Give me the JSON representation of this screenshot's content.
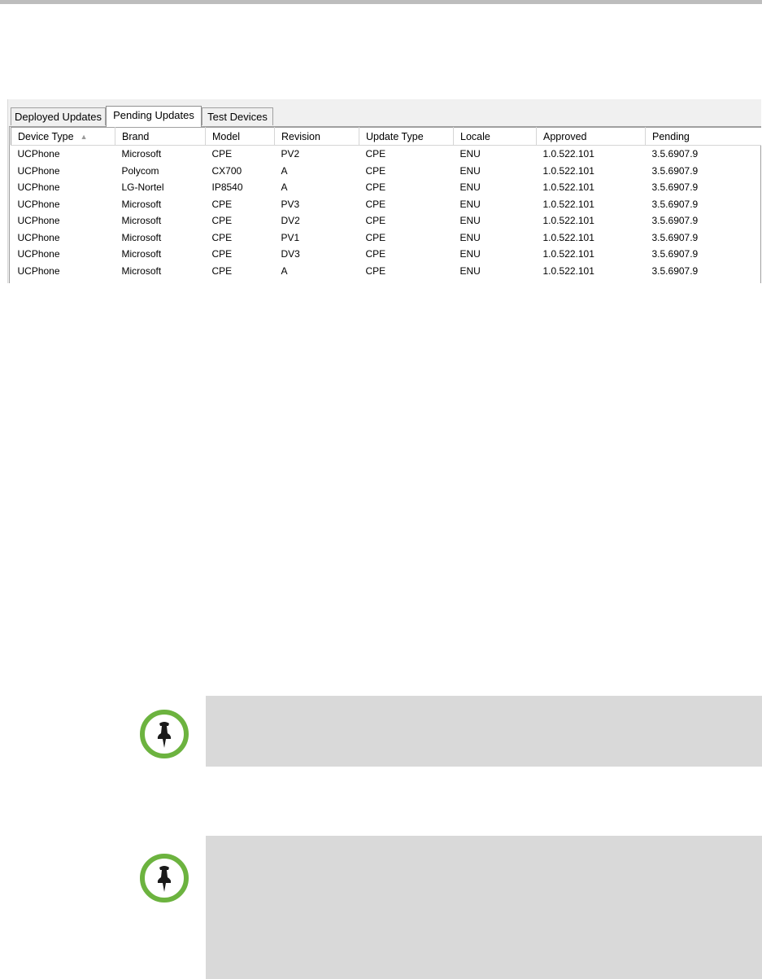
{
  "tabs": [
    {
      "label": "Deployed Updates",
      "active": false
    },
    {
      "label": "Pending Updates",
      "active": true
    },
    {
      "label": "Test Devices",
      "active": false
    }
  ],
  "table": {
    "columns": [
      "Device Type",
      "Brand",
      "Model",
      "Revision",
      "Update Type",
      "Locale",
      "Approved",
      "Pending"
    ],
    "sorted_column": "Device Type",
    "sort_direction": "ascending",
    "rows": [
      [
        "UCPhone",
        "Microsoft",
        "CPE",
        "PV2",
        "CPE",
        "ENU",
        "1.0.522.101",
        "3.5.6907.9"
      ],
      [
        "UCPhone",
        "Polycom",
        "CX700",
        "A",
        "CPE",
        "ENU",
        "1.0.522.101",
        "3.5.6907.9"
      ],
      [
        "UCPhone",
        "LG-Nortel",
        "IP8540",
        "A",
        "CPE",
        "ENU",
        "1.0.522.101",
        "3.5.6907.9"
      ],
      [
        "UCPhone",
        "Microsoft",
        "CPE",
        "PV3",
        "CPE",
        "ENU",
        "1.0.522.101",
        "3.5.6907.9"
      ],
      [
        "UCPhone",
        "Microsoft",
        "CPE",
        "DV2",
        "CPE",
        "ENU",
        "1.0.522.101",
        "3.5.6907.9"
      ],
      [
        "UCPhone",
        "Microsoft",
        "CPE",
        "PV1",
        "CPE",
        "ENU",
        "1.0.522.101",
        "3.5.6907.9"
      ],
      [
        "UCPhone",
        "Microsoft",
        "CPE",
        "DV3",
        "CPE",
        "ENU",
        "1.0.522.101",
        "3.5.6907.9"
      ],
      [
        "UCPhone",
        "Microsoft",
        "CPE",
        "A",
        "CPE",
        "ENU",
        "1.0.522.101",
        "3.5.6907.9"
      ]
    ]
  },
  "notes": [
    {
      "icon": "pushpin-icon",
      "text": ""
    },
    {
      "icon": "pushpin-icon",
      "text": ""
    }
  ],
  "colors": {
    "note_background": "#d9d9d9",
    "icon_ring": "#6cb33f",
    "top_rule": "#bdbdbd"
  }
}
